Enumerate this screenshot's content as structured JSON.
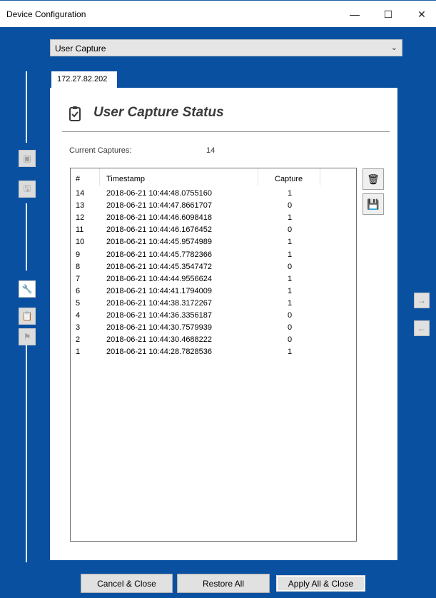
{
  "window": {
    "title": "Device Configuration",
    "min_glyph": "—",
    "max_glyph": "☐",
    "close_glyph": "✕"
  },
  "module_select": {
    "value": "User Capture",
    "chevron": "⌄"
  },
  "sidebar": {
    "buttons": [
      {
        "name": "open-image-icon",
        "glyph": "▣",
        "state": "disabled"
      },
      {
        "name": "save-disk-icon",
        "glyph": "🖫",
        "state": "disabled"
      },
      {
        "name": "wrench-icon",
        "glyph": "🔧",
        "state": "active"
      },
      {
        "name": "clipboard-icon",
        "glyph": "📋",
        "state": "disabled"
      },
      {
        "name": "flag-icon",
        "glyph": "⚑",
        "state": "disabled"
      }
    ]
  },
  "right_nav": {
    "next_glyph": "→",
    "prev_glyph": "←"
  },
  "tab": {
    "label": "172.27.82.202"
  },
  "panel": {
    "title": "User Capture Status",
    "captures_label": "Current Captures:",
    "captures_value": "14"
  },
  "table": {
    "headers": {
      "num": "#",
      "timestamp": "Timestamp",
      "capture": "Capture"
    },
    "rows": [
      {
        "num": "14",
        "timestamp": "2018-06-21 10:44:48.0755160",
        "capture": "1"
      },
      {
        "num": "13",
        "timestamp": "2018-06-21 10:44:47.8661707",
        "capture": "0"
      },
      {
        "num": "12",
        "timestamp": "2018-06-21 10:44:46.6098418",
        "capture": "1"
      },
      {
        "num": "11",
        "timestamp": "2018-06-21 10:44:46.1676452",
        "capture": "0"
      },
      {
        "num": "10",
        "timestamp": "2018-06-21 10:44:45.9574989",
        "capture": "1"
      },
      {
        "num": "9",
        "timestamp": "2018-06-21 10:44:45.7782366",
        "capture": "1"
      },
      {
        "num": "8",
        "timestamp": "2018-06-21 10:44:45.3547472",
        "capture": "0"
      },
      {
        "num": "7",
        "timestamp": "2018-06-21 10:44:44.9556624",
        "capture": "1"
      },
      {
        "num": "6",
        "timestamp": "2018-06-21 10:44:41.1794009",
        "capture": "1"
      },
      {
        "num": "5",
        "timestamp": "2018-06-21 10:44:38.3172267",
        "capture": "1"
      },
      {
        "num": "4",
        "timestamp": "2018-06-21 10:44:36.3356187",
        "capture": "0"
      },
      {
        "num": "3",
        "timestamp": "2018-06-21 10:44:30.7579939",
        "capture": "0"
      },
      {
        "num": "2",
        "timestamp": "2018-06-21 10:44:30.4688222",
        "capture": "0"
      },
      {
        "num": "1",
        "timestamp": "2018-06-21 10:44:28.7828536",
        "capture": "1"
      }
    ]
  },
  "tools": {
    "delete_glyph": "🗑",
    "save_glyph": "💾"
  },
  "footer": {
    "cancel_label": "Cancel & Close",
    "restore_label": "Restore All",
    "apply_label": "Apply All & Close"
  },
  "colors": {
    "accent": "#0a50a1",
    "panel_bg": "#ffffff",
    "title_text": "#3b3b3b"
  }
}
